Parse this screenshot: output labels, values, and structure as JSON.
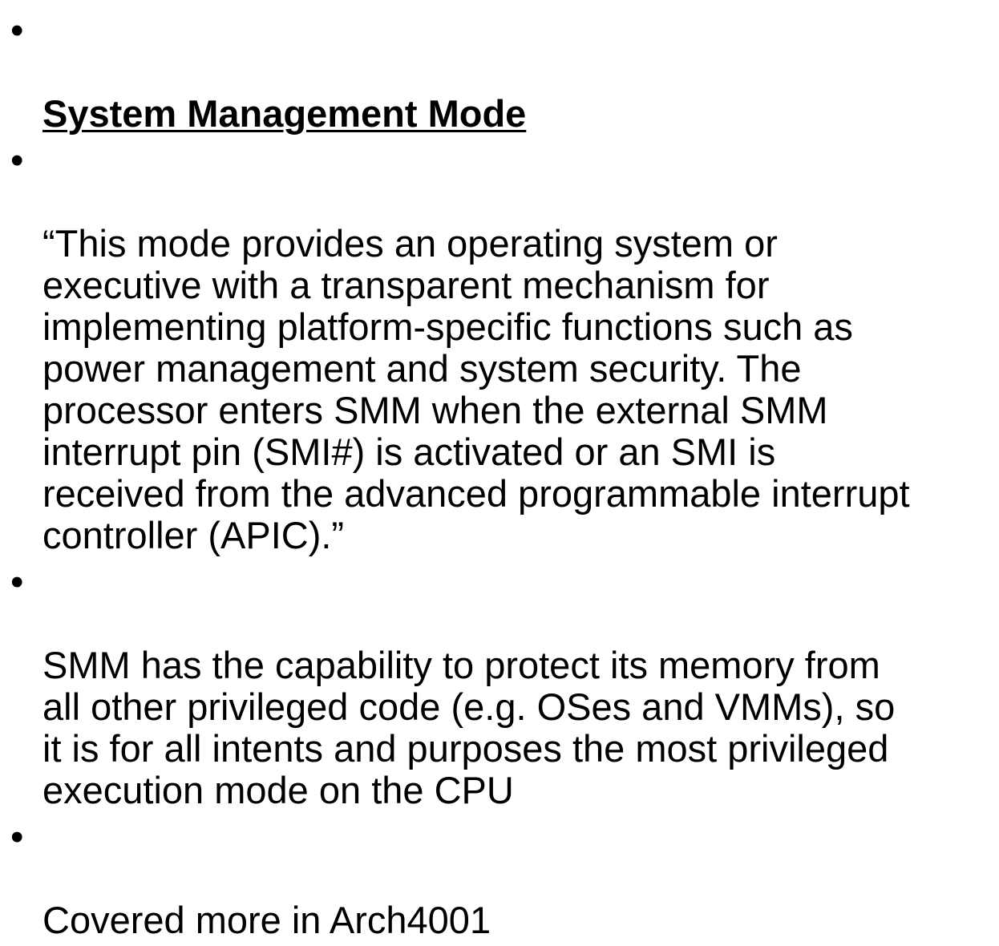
{
  "slide": {
    "heading": "System Management Mode",
    "bullets": [
      {
        "lines": "“This mode provides an operating system or\nexecutive with a transparent mechanism for\nimplementing platform-specific functions such as\npower management and system security. The\nprocessor enters SMM when the external SMM\ninterrupt pin (SMI#) is activated or an SMI is\nreceived from the advanced programmable interrupt\ncontroller (APIC).”"
      },
      {
        "lines": "SMM has the capability to protect its memory from\nall other privileged code (e.g. OSes and VMMs), so\nit is for all intents and purposes the most privileged\nexecution mode on the CPU"
      },
      {
        "lines": "Covered more in Arch4001"
      }
    ],
    "bullet_glyph": "•"
  }
}
